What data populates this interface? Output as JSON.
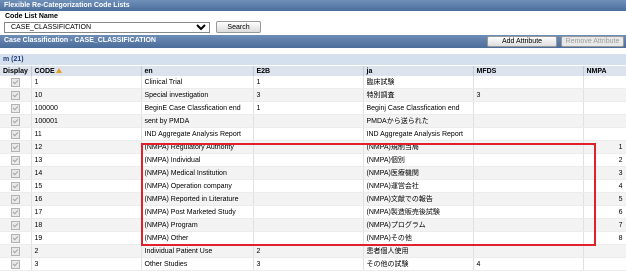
{
  "window": {
    "title": "Flexible Re-Categorization Code Lists"
  },
  "filter": {
    "code_list_label": "Code List Name",
    "code_list_value": "CASE_CLASSIFICATION",
    "search_label": "Search"
  },
  "panel": {
    "title": "Case Classification - CASE_CLASSIFICATION",
    "add_attribute_label": "Add Attribute",
    "remove_attribute_label": "Remove Attribute"
  },
  "group": {
    "label": "m (21)"
  },
  "table": {
    "columns": [
      "Display",
      "CODE",
      "en",
      "E2B",
      "ja",
      "MFDS",
      "NMPA"
    ],
    "rows": [
      {
        "code": "1",
        "en": "Clinical Trial",
        "e2b": "1",
        "ja": "臨床試験",
        "mfds": "",
        "nmpa": ""
      },
      {
        "code": "10",
        "en": "Special investigation",
        "e2b": "3",
        "ja": "特別調査",
        "mfds": "3",
        "nmpa": ""
      },
      {
        "code": "100000",
        "en": "BeginE Case Classfication end",
        "e2b": "1",
        "ja": "Beginj Case Classfication end",
        "mfds": "",
        "nmpa": ""
      },
      {
        "code": "100001",
        "en": "sent by PMDA",
        "e2b": "",
        "ja": "PMDAから送られた",
        "mfds": "",
        "nmpa": ""
      },
      {
        "code": "11",
        "en": "IND Aggregate Analysis Report",
        "e2b": "",
        "ja": "IND Aggregate Analysis Report",
        "mfds": "",
        "nmpa": ""
      },
      {
        "code": "12",
        "en": "(NMPA) Regulatory Authority",
        "e2b": "",
        "ja": "(NMPA)規制当局",
        "mfds": "",
        "nmpa": "1"
      },
      {
        "code": "13",
        "en": "(NMPA) Individual",
        "e2b": "",
        "ja": "(NMPA)個別",
        "mfds": "",
        "nmpa": "2"
      },
      {
        "code": "14",
        "en": "(NMPA) Medical Institution",
        "e2b": "",
        "ja": "(NMPA)医療機関",
        "mfds": "",
        "nmpa": "3"
      },
      {
        "code": "15",
        "en": "(NMPA) Operation company",
        "e2b": "",
        "ja": "(NMPA)運営会社",
        "mfds": "",
        "nmpa": "4"
      },
      {
        "code": "16",
        "en": "(NMPA) Reported in Literature",
        "e2b": "",
        "ja": "(NMPA)文献での報告",
        "mfds": "",
        "nmpa": "5"
      },
      {
        "code": "17",
        "en": "(NMPA) Post Marketed Study",
        "e2b": "",
        "ja": "(NMPA)製造販売後試験",
        "mfds": "",
        "nmpa": "6"
      },
      {
        "code": "18",
        "en": "(NMPA) Program",
        "e2b": "",
        "ja": "(NMPA)プログラム",
        "mfds": "",
        "nmpa": "7"
      },
      {
        "code": "19",
        "en": "(NMPA) Other",
        "e2b": "",
        "ja": "(NMPA)その他",
        "mfds": "",
        "nmpa": "8"
      },
      {
        "code": "2",
        "en": "Individual Patient Use",
        "e2b": "2",
        "ja": "患者個人使用",
        "mfds": "",
        "nmpa": ""
      },
      {
        "code": "3",
        "en": "Other Studies",
        "e2b": "3",
        "ja": "その他の試験",
        "mfds": "4",
        "nmpa": ""
      }
    ]
  },
  "colors": {
    "header_blue": "#4a6e9c",
    "highlight_red": "#e0202a",
    "sort_icon": "#e0a020"
  },
  "icons": {
    "sort": "sort-ascending-icon",
    "display_toggle": "checkbox-icon"
  }
}
